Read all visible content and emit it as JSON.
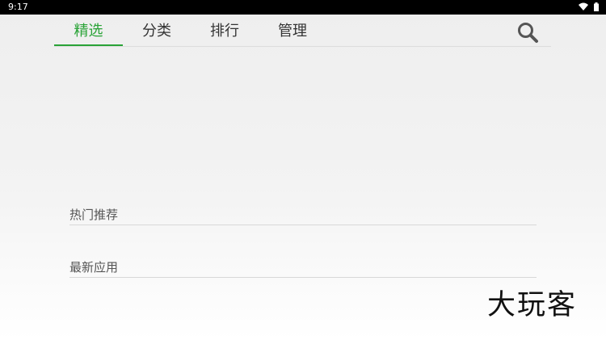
{
  "status_bar": {
    "time": "9:17"
  },
  "tabs": [
    {
      "label": "精选",
      "active": true
    },
    {
      "label": "分类",
      "active": false
    },
    {
      "label": "排行",
      "active": false
    },
    {
      "label": "管理",
      "active": false
    }
  ],
  "accent_color": "#2aa337",
  "search_icon": "search-icon",
  "sections": [
    {
      "title": "热门推荐"
    },
    {
      "title": "最新应用"
    }
  ],
  "logo_text": "大玩客"
}
